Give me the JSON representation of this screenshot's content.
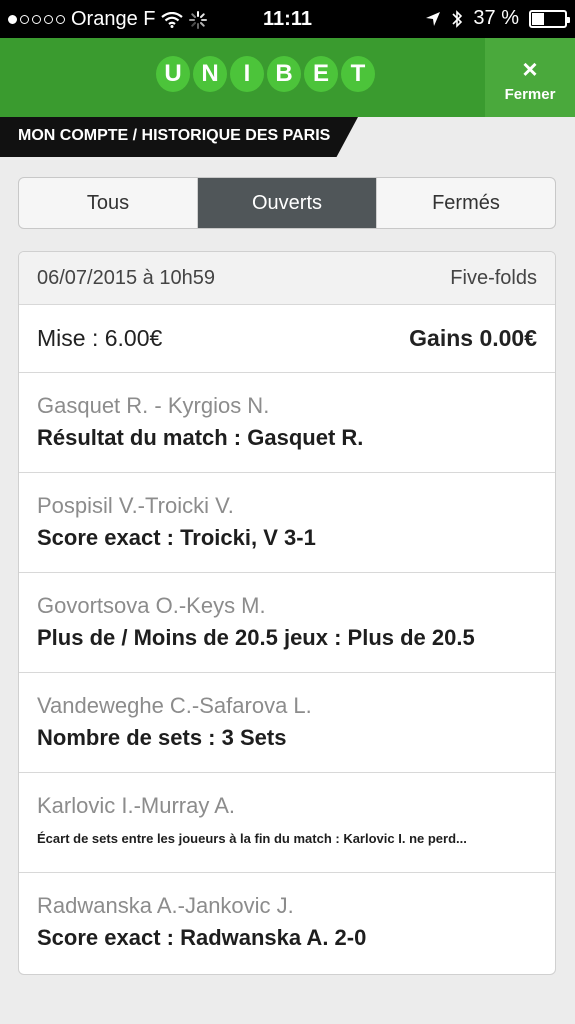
{
  "status_bar": {
    "carrier": "Orange F",
    "time": "11:11",
    "battery": "37 %",
    "battery_level": 0.37
  },
  "header": {
    "logo_letters": [
      "U",
      "N",
      "I",
      "B",
      "E",
      "T"
    ],
    "close_icon": "×",
    "close_label": "Fermer"
  },
  "breadcrumb": "MON COMPTE / HISTORIQUE DES PARIS",
  "tabs": [
    {
      "label": "Tous",
      "active": false
    },
    {
      "label": "Ouverts",
      "active": true
    },
    {
      "label": "Fermés",
      "active": false
    }
  ],
  "bet_slip": {
    "date": "06/07/2015 à 10h59",
    "type": "Five-folds",
    "stake": "Mise : 6.00€",
    "gains": "Gains 0.00€",
    "selections": [
      {
        "match": "Gasquet R. - Kyrgios N.",
        "pick": "Résultat du match : Gasquet R."
      },
      {
        "match": "Pospisil V.-Troicki V.",
        "pick": "Score exact : Troicki, V 3-1"
      },
      {
        "match": "Govortsova O.-Keys M.",
        "pick": "Plus de / Moins de 20.5 jeux : Plus de 20.5"
      },
      {
        "match": "Vandeweghe C.-Safarova L.",
        "pick": "Nombre de sets : 3 Sets"
      },
      {
        "match": "Karlovic I.-Murray A.",
        "pick": "Écart de sets entre les joueurs à la fin du match : Karlovic I. ne perd..."
      },
      {
        "match": "Radwanska A.-Jankovic J.",
        "pick": "Score exact : Radwanska A. 2-0"
      }
    ]
  }
}
